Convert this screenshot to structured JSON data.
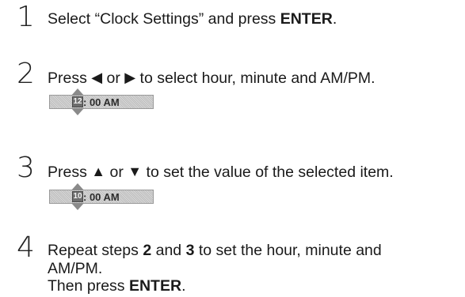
{
  "steps": [
    {
      "number": "1",
      "text_1": "Select “Clock Settings” and press ",
      "bold_1": "ENTER",
      "text_2": "."
    },
    {
      "number": "2",
      "text_1": "Press ",
      "left_arrow": "◀",
      "text_2": " or ",
      "right_arrow": "▶",
      "text_3": " to select hour, minute and AM/PM.",
      "clock": {
        "selected_value": "12",
        "rest": ": 00 AM"
      }
    },
    {
      "number": "3",
      "text_1": "Press ",
      "up_arrow": "▲",
      "text_2": " or ",
      "down_arrow": "▼",
      "text_3": " to set the value of the selected item.",
      "clock": {
        "selected_value": "10",
        "rest": ": 00 AM"
      }
    },
    {
      "number": "4",
      "line1_a": "Repeat steps ",
      "line1_b": "2",
      "line1_c": " and ",
      "line1_d": "3",
      "line1_e": " to set the hour, minute and",
      "line2": "AM/PM.",
      "line3_a": "Then press ",
      "line3_b": "ENTER",
      "line3_c": "."
    }
  ],
  "colors": {
    "text": "#1a1a1a",
    "clock_bg": "#d0d0d0",
    "clock_selected": "#6d6d6d"
  }
}
